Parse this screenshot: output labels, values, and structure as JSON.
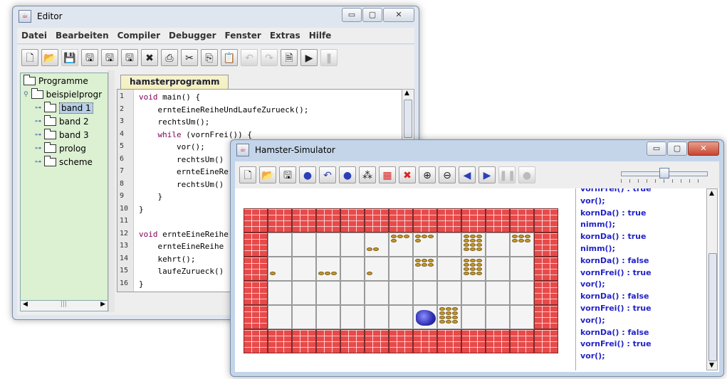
{
  "editor": {
    "title": "Editor",
    "menu": [
      "Datei",
      "Bearbeiten",
      "Compiler",
      "Debugger",
      "Fenster",
      "Extras",
      "Hilfe"
    ],
    "toolbar_icons": [
      {
        "name": "new-file-icon",
        "glyph": "🗋",
        "state": "enabled"
      },
      {
        "name": "open-folder-icon",
        "glyph": "📂",
        "state": "enabled"
      },
      {
        "name": "save-icon",
        "glyph": "💾",
        "state": "disabled"
      },
      {
        "name": "save-as-icon",
        "glyph": "🖫",
        "state": "enabled"
      },
      {
        "name": "save-all-icon",
        "glyph": "🖫",
        "state": "enabled"
      },
      {
        "name": "save-all-as-icon",
        "glyph": "🖫",
        "state": "enabled"
      },
      {
        "name": "close-file-icon",
        "glyph": "✖",
        "state": "enabled"
      },
      {
        "name": "print-icon",
        "glyph": "⎙",
        "state": "enabled"
      },
      {
        "name": "cut-icon",
        "glyph": "✂",
        "state": "enabled"
      },
      {
        "name": "copy-icon",
        "glyph": "⎘",
        "state": "enabled"
      },
      {
        "name": "paste-icon",
        "glyph": "📋",
        "state": "enabled"
      },
      {
        "name": "undo-icon",
        "glyph": "↶",
        "state": "disabled"
      },
      {
        "name": "redo-icon",
        "glyph": "↷",
        "state": "disabled"
      },
      {
        "name": "compile-icon",
        "glyph": "🗎",
        "state": "enabled"
      },
      {
        "name": "run-icon",
        "glyph": "▶",
        "state": "enabled"
      },
      {
        "name": "pause-icon",
        "glyph": "❚",
        "state": "disabled"
      }
    ],
    "tree": {
      "root": "Programme",
      "child": "beispielprogr",
      "items": [
        "band 1",
        "band 2",
        "band 3",
        "prolog",
        "scheme"
      ],
      "selected": "band 1"
    },
    "tab": "hamsterprogramm",
    "code_lines": [
      {
        "n": "1",
        "text": "void main() {"
      },
      {
        "n": "2",
        "text": "    ernteEineReiheUndLaufeZurueck();"
      },
      {
        "n": "3",
        "text": "    rechtsUm();"
      },
      {
        "n": "4",
        "text": "    while (vornFrei()) {"
      },
      {
        "n": "5",
        "text": "        vor();"
      },
      {
        "n": "6",
        "text": "        rechtsUm()"
      },
      {
        "n": "7",
        "text": "        ernteEineRe"
      },
      {
        "n": "8",
        "text": "        rechtsUm()"
      },
      {
        "n": "9",
        "text": "    }"
      },
      {
        "n": "10",
        "text": "}"
      },
      {
        "n": "11",
        "text": ""
      },
      {
        "n": "12",
        "text": "void ernteEineReihe"
      },
      {
        "n": "13",
        "text": "    ernteEineReihe"
      },
      {
        "n": "14",
        "text": "    kehrt();"
      },
      {
        "n": "15",
        "text": "    laufeZurueck()"
      },
      {
        "n": "16",
        "text": "}"
      }
    ]
  },
  "simulator": {
    "title": "Hamster-Simulator",
    "toolbar_icons": [
      {
        "name": "new-territory-icon",
        "glyph": "🗋",
        "state": "enabled"
      },
      {
        "name": "open-territory-icon",
        "glyph": "📂",
        "state": "enabled"
      },
      {
        "name": "save-territory-icon",
        "glyph": "🖫",
        "state": "enabled"
      },
      {
        "name": "place-hamster-icon",
        "glyph": "●",
        "state": "blue"
      },
      {
        "name": "turn-left-icon",
        "glyph": "↶",
        "state": "blue"
      },
      {
        "name": "hamster-grains-icon",
        "glyph": "●",
        "state": "blue"
      },
      {
        "name": "grain-icon",
        "glyph": "⁂",
        "state": "enabled"
      },
      {
        "name": "wall-icon",
        "glyph": "▦",
        "state": "red"
      },
      {
        "name": "delete-icon",
        "glyph": "✖",
        "state": "red"
      },
      {
        "name": "zoom-in-icon",
        "glyph": "⊕",
        "state": "enabled"
      },
      {
        "name": "zoom-out-icon",
        "glyph": "⊖",
        "state": "enabled"
      },
      {
        "name": "step-back-icon",
        "glyph": "◀",
        "state": "blue"
      },
      {
        "name": "play-icon",
        "glyph": "▶",
        "state": "blue"
      },
      {
        "name": "pause-icon",
        "glyph": "❚❚",
        "state": "disabled"
      },
      {
        "name": "stop-icon",
        "glyph": "●",
        "state": "disabled"
      }
    ],
    "speed_level": 0.5,
    "grid": {
      "rows": 6,
      "cols": 13,
      "walls": "perimeter",
      "hamster": {
        "row": 4,
        "col": 7,
        "facing": "east"
      },
      "grains": [
        {
          "row": 1,
          "col": 5,
          "count": 2
        },
        {
          "row": 1,
          "col": 6,
          "count": 4
        },
        {
          "row": 1,
          "col": 7,
          "count": 4
        },
        {
          "row": 1,
          "col": 9,
          "count": 12
        },
        {
          "row": 1,
          "col": 11,
          "count": 6
        },
        {
          "row": 2,
          "col": 1,
          "count": 1
        },
        {
          "row": 2,
          "col": 3,
          "count": 3
        },
        {
          "row": 2,
          "col": 5,
          "count": 1
        },
        {
          "row": 2,
          "col": 7,
          "count": 6
        },
        {
          "row": 2,
          "col": 9,
          "count": 12
        },
        {
          "row": 4,
          "col": 8,
          "count": 12
        }
      ]
    },
    "log": [
      "vornFrei() : true",
      "vor();",
      "kornDa() : true",
      "nimm();",
      "kornDa() : true",
      "nimm();",
      "kornDa() : false",
      "vornFrei() : true",
      "vor();",
      "kornDa() : false",
      "vornFrei() : true",
      "vor();",
      "kornDa() : false",
      "vornFrei() : true",
      "vor();"
    ]
  },
  "window_controls": {
    "minimize": "▭",
    "maximize": "▢",
    "close": "✕"
  }
}
